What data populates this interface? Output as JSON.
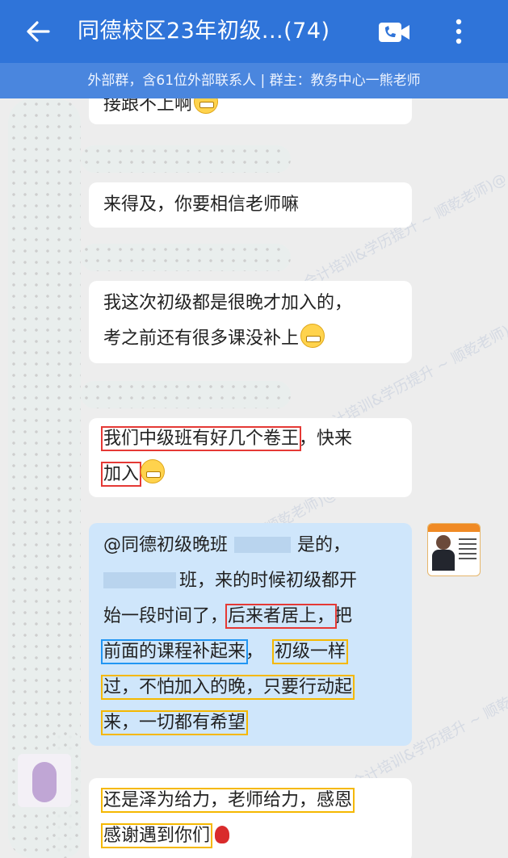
{
  "header": {
    "title": "同德校区23年初级...(74)",
    "subtitle": "外部群，含61位外部联系人 | 群主：教务中心一熊老师"
  },
  "watermark": "会计培训&学历提升 ~ 顺乾老师)@",
  "messages": [
    {
      "lines": [
        "接跟不上啊"
      ]
    },
    {
      "lines": [
        "来得及，你要相信老师嘛"
      ]
    },
    {
      "lines": [
        "我这次初级都是很晚才加入的，",
        "考之前还有很多课没补上"
      ]
    },
    {
      "lines": [
        "我们中级班有好几个卷王，快来",
        "加入"
      ],
      "p1": "我们中级班有好几个卷王",
      "p2": "，快来",
      "p3": "加入"
    },
    {
      "mention": "@同德初级晚班",
      "tail": "是的，",
      "l2": "班，来的时候初级都开",
      "l3a": "始一段时间了，",
      "l3b": "后来者居上，",
      "l3c": "把",
      "l4a": "前面的课程补起来",
      "l4b": "，",
      "l4c": "初级一样",
      "l5": "过，不怕加入的晚，只要行动起",
      "l6": "来，一切都有希望"
    },
    {
      "l1": "还是泽为给力，老师给力，感恩",
      "l2": "感谢遇到你们"
    }
  ]
}
